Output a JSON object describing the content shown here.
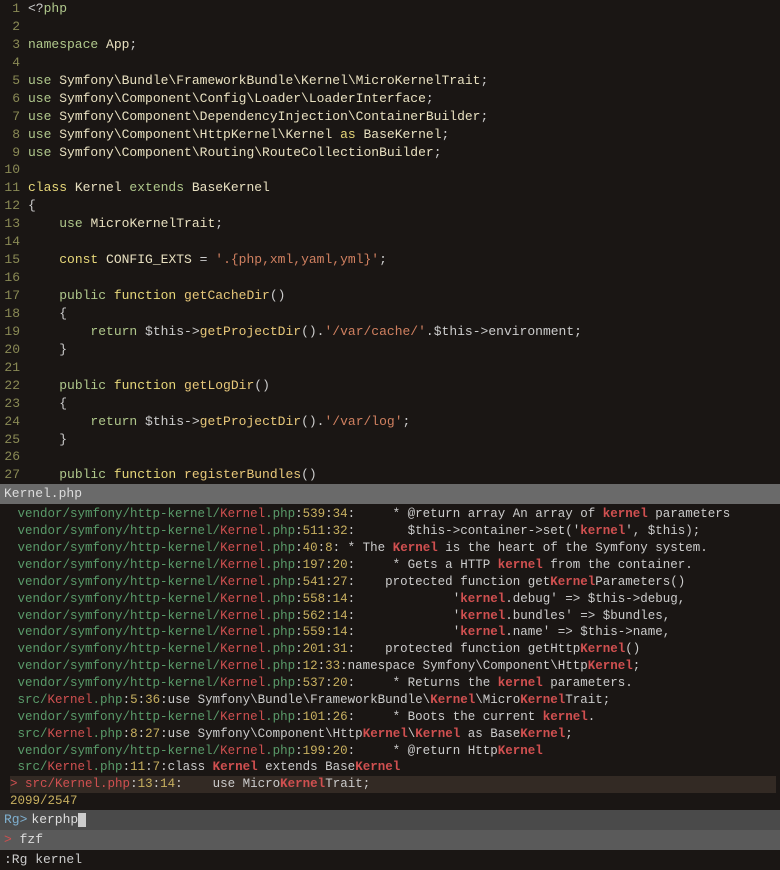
{
  "editor": {
    "lines": [
      {
        "n": 1,
        "tokens": [
          {
            "t": "<?",
            "c": "op"
          },
          {
            "t": "php",
            "c": "kw2"
          }
        ]
      },
      {
        "n": 2,
        "tokens": []
      },
      {
        "n": 3,
        "tokens": [
          {
            "t": "namespace ",
            "c": "kw2"
          },
          {
            "t": "App",
            "c": "cls"
          },
          {
            "t": ";",
            "c": "op"
          }
        ]
      },
      {
        "n": 4,
        "tokens": []
      },
      {
        "n": 5,
        "tokens": [
          {
            "t": "use ",
            "c": "kw2"
          },
          {
            "t": "Symfony\\Bundle\\FrameworkBundle\\Kernel\\MicroKernelTrait",
            "c": "cls"
          },
          {
            "t": ";",
            "c": "op"
          }
        ]
      },
      {
        "n": 6,
        "tokens": [
          {
            "t": "use ",
            "c": "kw2"
          },
          {
            "t": "Symfony\\Component\\Config\\Loader\\LoaderInterface",
            "c": "cls"
          },
          {
            "t": ";",
            "c": "op"
          }
        ]
      },
      {
        "n": 7,
        "tokens": [
          {
            "t": "use ",
            "c": "kw2"
          },
          {
            "t": "Symfony\\Component\\DependencyInjection\\ContainerBuilder",
            "c": "cls"
          },
          {
            "t": ";",
            "c": "op"
          }
        ]
      },
      {
        "n": 8,
        "tokens": [
          {
            "t": "use ",
            "c": "kw2"
          },
          {
            "t": "Symfony\\Component\\HttpKernel\\Kernel ",
            "c": "cls"
          },
          {
            "t": "as ",
            "c": "kw"
          },
          {
            "t": "BaseKernel",
            "c": "cls"
          },
          {
            "t": ";",
            "c": "op"
          }
        ]
      },
      {
        "n": 9,
        "tokens": [
          {
            "t": "use ",
            "c": "kw2"
          },
          {
            "t": "Symfony\\Component\\Routing\\RouteCollectionBuilder",
            "c": "cls"
          },
          {
            "t": ";",
            "c": "op"
          }
        ]
      },
      {
        "n": 10,
        "tokens": []
      },
      {
        "n": 11,
        "tokens": [
          {
            "t": "class ",
            "c": "kw"
          },
          {
            "t": "Kernel ",
            "c": "cls"
          },
          {
            "t": "extends ",
            "c": "kw2"
          },
          {
            "t": "BaseKernel",
            "c": "cls"
          }
        ]
      },
      {
        "n": 12,
        "tokens": [
          {
            "t": "{",
            "c": "op"
          }
        ]
      },
      {
        "n": 13,
        "tokens": [
          {
            "t": "    ",
            "c": "op"
          },
          {
            "t": "use ",
            "c": "kw2"
          },
          {
            "t": "MicroKernelTrait",
            "c": "cls"
          },
          {
            "t": ";",
            "c": "op"
          }
        ]
      },
      {
        "n": 14,
        "tokens": []
      },
      {
        "n": 15,
        "tokens": [
          {
            "t": "    ",
            "c": "op"
          },
          {
            "t": "const ",
            "c": "kw"
          },
          {
            "t": "CONFIG_EXTS ",
            "c": "cls"
          },
          {
            "t": "= ",
            "c": "op"
          },
          {
            "t": "'.{php,xml,yaml,yml}'",
            "c": "str"
          },
          {
            "t": ";",
            "c": "op"
          }
        ]
      },
      {
        "n": 16,
        "tokens": []
      },
      {
        "n": 17,
        "tokens": [
          {
            "t": "    ",
            "c": "op"
          },
          {
            "t": "public ",
            "c": "kw2"
          },
          {
            "t": "function ",
            "c": "kw"
          },
          {
            "t": "getCacheDir",
            "c": "fn"
          },
          {
            "t": "()",
            "c": "op"
          }
        ]
      },
      {
        "n": 18,
        "tokens": [
          {
            "t": "    {",
            "c": "op"
          }
        ]
      },
      {
        "n": 19,
        "tokens": [
          {
            "t": "        ",
            "c": "op"
          },
          {
            "t": "return ",
            "c": "kw2"
          },
          {
            "t": "$this",
            "c": "var"
          },
          {
            "t": "->",
            "c": "op"
          },
          {
            "t": "getProjectDir",
            "c": "fn"
          },
          {
            "t": "().",
            "c": "op"
          },
          {
            "t": "'/var/cache/'",
            "c": "str"
          },
          {
            "t": ".",
            "c": "op"
          },
          {
            "t": "$this",
            "c": "var"
          },
          {
            "t": "->",
            "c": "op"
          },
          {
            "t": "environment",
            "c": "var"
          },
          {
            "t": ";",
            "c": "op"
          }
        ]
      },
      {
        "n": 20,
        "tokens": [
          {
            "t": "    }",
            "c": "op"
          }
        ]
      },
      {
        "n": 21,
        "tokens": []
      },
      {
        "n": 22,
        "tokens": [
          {
            "t": "    ",
            "c": "op"
          },
          {
            "t": "public ",
            "c": "kw2"
          },
          {
            "t": "function ",
            "c": "kw"
          },
          {
            "t": "getLogDir",
            "c": "fn"
          },
          {
            "t": "()",
            "c": "op"
          }
        ]
      },
      {
        "n": 23,
        "tokens": [
          {
            "t": "    {",
            "c": "op"
          }
        ]
      },
      {
        "n": 24,
        "tokens": [
          {
            "t": "        ",
            "c": "op"
          },
          {
            "t": "return ",
            "c": "kw2"
          },
          {
            "t": "$this",
            "c": "var"
          },
          {
            "t": "->",
            "c": "op"
          },
          {
            "t": "getProjectDir",
            "c": "fn"
          },
          {
            "t": "().",
            "c": "op"
          },
          {
            "t": "'/var/log'",
            "c": "str"
          },
          {
            "t": ";",
            "c": "op"
          }
        ]
      },
      {
        "n": 25,
        "tokens": [
          {
            "t": "    }",
            "c": "op"
          }
        ]
      },
      {
        "n": 26,
        "tokens": []
      },
      {
        "n": 27,
        "tokens": [
          {
            "t": "    ",
            "c": "op"
          },
          {
            "t": "public ",
            "c": "kw2"
          },
          {
            "t": "function ",
            "c": "kw"
          },
          {
            "t": "registerBundles",
            "c": "fn"
          },
          {
            "t": "()",
            "c": "op"
          }
        ]
      }
    ]
  },
  "filebar": "Kernel.php",
  "results": [
    {
      "path": "vendor/symfony/http-kernel/",
      "file": "Kernel",
      "ext": ".php",
      "l": "539",
      "c": "34",
      "pre": "     * @return array An array of ",
      "m": "kernel",
      "post": " parameters"
    },
    {
      "path": "vendor/symfony/http-kernel/",
      "file": "Kernel",
      "ext": ".php",
      "l": "511",
      "c": "32",
      "pre": "       $this->container->set('",
      "m": "kernel",
      "post": "', $this);"
    },
    {
      "path": "vendor/symfony/http-kernel/",
      "file": "Kernel",
      "ext": ".php",
      "l": "40",
      "c": "8",
      "pre": " * The ",
      "m": "Kernel",
      "post": " is the heart of the Symfony system."
    },
    {
      "path": "vendor/symfony/http-kernel/",
      "file": "Kernel",
      "ext": ".php",
      "l": "197",
      "c": "20",
      "pre": "     * Gets a HTTP ",
      "m": "kernel",
      "post": " from the container."
    },
    {
      "path": "vendor/symfony/http-kernel/",
      "file": "Kernel",
      "ext": ".php",
      "l": "541",
      "c": "27",
      "pre": "    protected function get",
      "m": "Kernel",
      "post": "Parameters()"
    },
    {
      "path": "vendor/symfony/http-kernel/",
      "file": "Kernel",
      "ext": ".php",
      "l": "558",
      "c": "14",
      "pre": "             '",
      "m": "kernel",
      "post": ".debug' => $this->debug,"
    },
    {
      "path": "vendor/symfony/http-kernel/",
      "file": "Kernel",
      "ext": ".php",
      "l": "562",
      "c": "14",
      "pre": "             '",
      "m": "kernel",
      "post": ".bundles' => $bundles,"
    },
    {
      "path": "vendor/symfony/http-kernel/",
      "file": "Kernel",
      "ext": ".php",
      "l": "559",
      "c": "14",
      "pre": "             '",
      "m": "kernel",
      "post": ".name' => $this->name,"
    },
    {
      "path": "vendor/symfony/http-kernel/",
      "file": "Kernel",
      "ext": ".php",
      "l": "201",
      "c": "31",
      "pre": "    protected function getHttp",
      "m": "Kernel",
      "post": "()"
    },
    {
      "path": "vendor/symfony/http-kernel/",
      "file": "Kernel",
      "ext": ".php",
      "l": "12",
      "c": "33",
      "pre": "namespace Symfony\\Component\\Http",
      "m": "Kernel",
      "post": ";"
    },
    {
      "path": "vendor/symfony/http-kernel/",
      "file": "Kernel",
      "ext": ".php",
      "l": "537",
      "c": "20",
      "pre": "     * Returns the ",
      "m": "kernel",
      "post": " parameters."
    },
    {
      "path": "src/",
      "file": "Kernel",
      "ext": ".php",
      "l": "5",
      "c": "36",
      "pre": "use Symfony\\Bundle\\FrameworkBundle\\",
      "m": "Kernel",
      "post": "\\Micro",
      "m2": "Kernel",
      "post2": "Trait;"
    },
    {
      "path": "vendor/symfony/http-kernel/",
      "file": "Kernel",
      "ext": ".php",
      "l": "101",
      "c": "26",
      "pre": "     * Boots the current ",
      "m": "kernel",
      "post": "."
    },
    {
      "path": "src/",
      "file": "Kernel",
      "ext": ".php",
      "l": "8",
      "c": "27",
      "pre": "use Symfony\\Component\\Http",
      "m": "Kernel",
      "post": "\\",
      "m2": "Kernel",
      "post2": " as Base",
      "m3": "Kernel",
      "post3": ";"
    },
    {
      "path": "vendor/symfony/http-kernel/",
      "file": "Kernel",
      "ext": ".php",
      "l": "199",
      "c": "20",
      "pre": "     * @return Http",
      "m": "Kernel",
      "post": ""
    },
    {
      "path": "src/",
      "file": "Kernel",
      "ext": ".php",
      "l": "11",
      "c": "7",
      "pre": "class ",
      "m": "Kernel",
      "post": " extends Base",
      "m2": "Kernel",
      "post2": ""
    }
  ],
  "selected": {
    "marker": ">",
    "path": "src/",
    "file": "Kernel",
    "ext": ".php",
    "l": "13",
    "c": "14",
    "pre": "    use Micro",
    "m": "Kernel",
    "post": "Trait;"
  },
  "counter": "2099/2547",
  "prompt": {
    "label": "Rg>",
    "value": "kerphp"
  },
  "fzf": {
    "marker": ">",
    "text": "fzf"
  },
  "cmd": ":Rg kernel"
}
